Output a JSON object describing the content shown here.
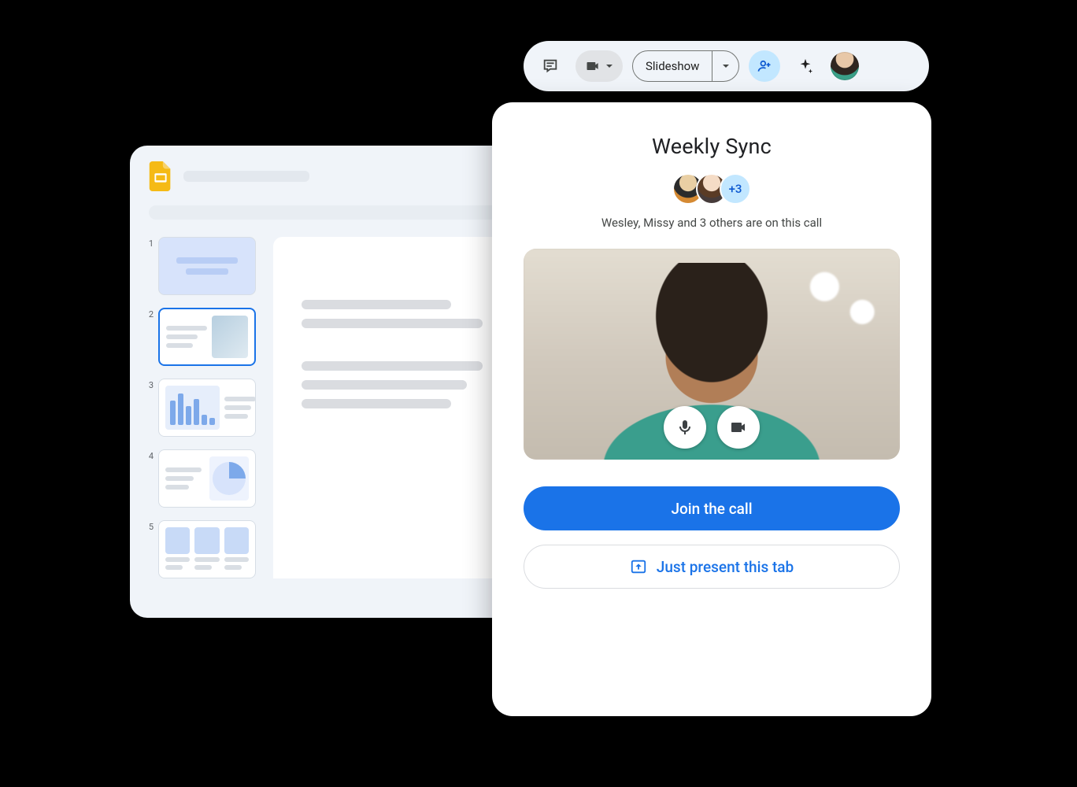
{
  "toolbar": {
    "slideshow_label": "Slideshow"
  },
  "slides": {
    "thumbs": [
      {
        "n": "1"
      },
      {
        "n": "2"
      },
      {
        "n": "3"
      },
      {
        "n": "4"
      },
      {
        "n": "5"
      }
    ]
  },
  "meet": {
    "title": "Weekly Sync",
    "more_badge": "+3",
    "subtitle": "Wesley, Missy and 3 others are on this call",
    "join_label": "Join the call",
    "present_label": "Just present this tab"
  }
}
